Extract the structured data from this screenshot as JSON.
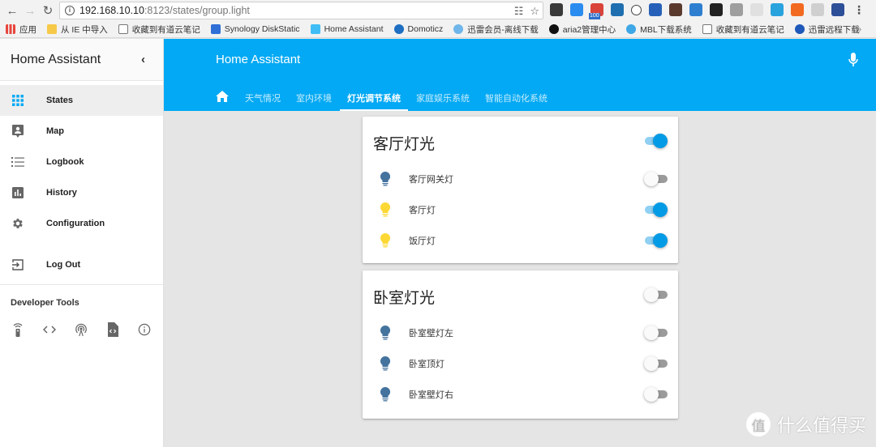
{
  "browser": {
    "url_host": "192.168.10.10",
    "url_path": ":8123/states/group.light",
    "extensions": [
      {
        "name": "evernote-icon",
        "color": "#3a3a3a"
      },
      {
        "name": "blue-ext-icon",
        "color": "#2b8cf0"
      },
      {
        "name": "adblock-icon",
        "color": "#d9433a",
        "badge": "100"
      },
      {
        "name": "bird-ext-icon",
        "color": "#1f6fb0"
      },
      {
        "name": "onepassword-icon",
        "color": "#ffffff"
      },
      {
        "name": "bookmark-ext-icon",
        "color": "#2760b8"
      },
      {
        "name": "camera-ext-icon",
        "color": "#5b3a2e"
      },
      {
        "name": "s-ext-icon",
        "color": "#2f7fd0"
      },
      {
        "name": "color-wheel-icon",
        "color": "#222222"
      },
      {
        "name": "gray-ext-icon",
        "color": "#9e9e9e"
      },
      {
        "name": "shield-ext-icon",
        "color": "#e0e0e0"
      },
      {
        "name": "paint-ext-icon",
        "color": "#29a3dd"
      },
      {
        "name": "mi-ext-icon",
        "color": "#f26a21"
      },
      {
        "name": "globe-ext-icon",
        "color": "#cfcfcf"
      },
      {
        "name": "arrow-ext-icon",
        "color": "#2d4f98"
      }
    ],
    "bookmarks": [
      {
        "label": "应用",
        "icon": "apps-grid-icon",
        "color": "#e8a13a"
      },
      {
        "label": "从 IE 中导入",
        "icon": "folder-icon",
        "color": "#f7c948"
      },
      {
        "label": "收藏到有道云笔记",
        "icon": "page-icon",
        "color": "#ffffff"
      },
      {
        "label": "Synology DiskStatic",
        "icon": "dsm-icon",
        "color": "#2f6fd6"
      },
      {
        "label": "Home Assistant",
        "icon": "home-assistant-icon",
        "color": "#41bdf5"
      },
      {
        "label": "Domoticz",
        "icon": "domoticz-icon",
        "color": "#1e6fc2"
      },
      {
        "label": "迅雷会员-离线下载",
        "icon": "thunder-icon",
        "color": "#6fb6ea"
      },
      {
        "label": "aria2管理中心",
        "icon": "download-circle-icon",
        "color": "#111111"
      },
      {
        "label": "MBL下载系统",
        "icon": "chat-bubble-icon",
        "color": "#3fa7e6"
      },
      {
        "label": "收藏到有道云笔记",
        "icon": "page-icon",
        "color": "#ffffff"
      },
      {
        "label": "迅雷远程下载",
        "icon": "thunder-remote-icon",
        "color": "#1e58b8"
      }
    ],
    "more_bookmarks": "»"
  },
  "sidebar": {
    "title": "Home Assistant",
    "items": [
      {
        "label": "States",
        "icon": "grid-icon",
        "active": true
      },
      {
        "label": "Map",
        "icon": "map-marker-icon"
      },
      {
        "label": "Logbook",
        "icon": "list-icon"
      },
      {
        "label": "History",
        "icon": "chart-icon"
      },
      {
        "label": "Configuration",
        "icon": "gear-icon"
      }
    ],
    "logout": {
      "label": "Log Out",
      "icon": "logout-icon"
    },
    "dev_tools_title": "Developer Tools",
    "dev_tools": [
      {
        "name": "service-remote-icon"
      },
      {
        "name": "code-brackets-icon"
      },
      {
        "name": "mqtt-antenna-icon"
      },
      {
        "name": "template-file-icon"
      },
      {
        "name": "info-icon"
      }
    ]
  },
  "header": {
    "title": "Home Assistant",
    "tabs": [
      {
        "label": "",
        "icon": "home-icon"
      },
      {
        "label": "天气情况"
      },
      {
        "label": "室内环境"
      },
      {
        "label": "灯光调节系统",
        "active": true
      },
      {
        "label": "家庭娱乐系统"
      },
      {
        "label": "智能自动化系统"
      }
    ]
  },
  "cards": [
    {
      "title": "客厅灯光",
      "on": true,
      "entities": [
        {
          "label": "客厅网关灯",
          "on": false
        },
        {
          "label": "客厅灯",
          "on": true
        },
        {
          "label": "饭厅灯",
          "on": true
        }
      ]
    },
    {
      "title": "卧室灯光",
      "on": false,
      "entities": [
        {
          "label": "卧室壁灯左",
          "on": false
        },
        {
          "label": "卧室顶灯",
          "on": false
        },
        {
          "label": "卧室壁灯右",
          "on": false
        }
      ]
    }
  ],
  "colors": {
    "accent": "#03a9f4",
    "toggle_on": "#039be5",
    "bulb_on": "#fdd835",
    "bulb_off": "#44739e"
  },
  "watermark": {
    "icon_char": "值",
    "text": "什么值得买"
  }
}
